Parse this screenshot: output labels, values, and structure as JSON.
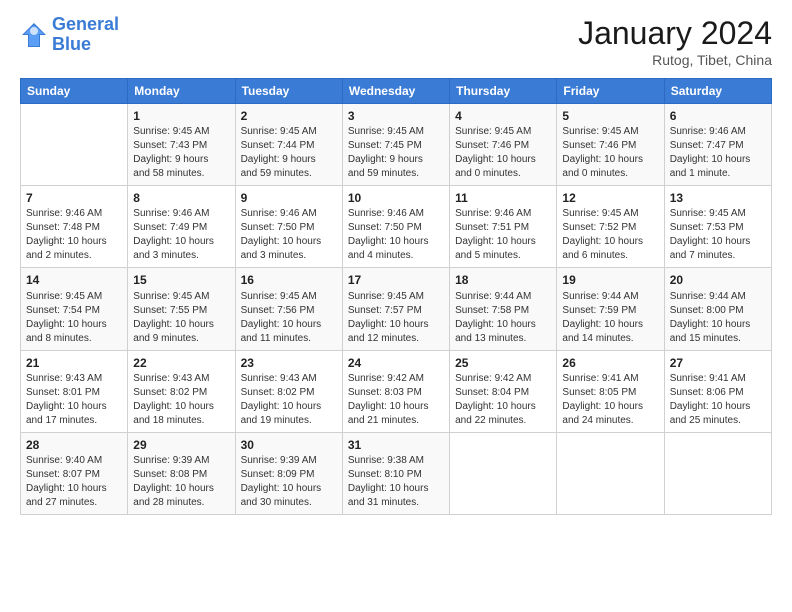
{
  "logo": {
    "line1": "General",
    "line2": "Blue"
  },
  "title": "January 2024",
  "subtitle": "Rutog, Tibet, China",
  "days": [
    "Sunday",
    "Monday",
    "Tuesday",
    "Wednesday",
    "Thursday",
    "Friday",
    "Saturday"
  ],
  "weeks": [
    [
      {
        "date": "",
        "text": ""
      },
      {
        "date": "1",
        "text": "Sunrise: 9:45 AM\nSunset: 7:43 PM\nDaylight: 9 hours\nand 58 minutes."
      },
      {
        "date": "2",
        "text": "Sunrise: 9:45 AM\nSunset: 7:44 PM\nDaylight: 9 hours\nand 59 minutes."
      },
      {
        "date": "3",
        "text": "Sunrise: 9:45 AM\nSunset: 7:45 PM\nDaylight: 9 hours\nand 59 minutes."
      },
      {
        "date": "4",
        "text": "Sunrise: 9:45 AM\nSunset: 7:46 PM\nDaylight: 10 hours\nand 0 minutes."
      },
      {
        "date": "5",
        "text": "Sunrise: 9:45 AM\nSunset: 7:46 PM\nDaylight: 10 hours\nand 0 minutes."
      },
      {
        "date": "6",
        "text": "Sunrise: 9:46 AM\nSunset: 7:47 PM\nDaylight: 10 hours\nand 1 minute."
      }
    ],
    [
      {
        "date": "7",
        "text": "Sunrise: 9:46 AM\nSunset: 7:48 PM\nDaylight: 10 hours\nand 2 minutes."
      },
      {
        "date": "8",
        "text": "Sunrise: 9:46 AM\nSunset: 7:49 PM\nDaylight: 10 hours\nand 3 minutes."
      },
      {
        "date": "9",
        "text": "Sunrise: 9:46 AM\nSunset: 7:50 PM\nDaylight: 10 hours\nand 3 minutes."
      },
      {
        "date": "10",
        "text": "Sunrise: 9:46 AM\nSunset: 7:50 PM\nDaylight: 10 hours\nand 4 minutes."
      },
      {
        "date": "11",
        "text": "Sunrise: 9:46 AM\nSunset: 7:51 PM\nDaylight: 10 hours\nand 5 minutes."
      },
      {
        "date": "12",
        "text": "Sunrise: 9:45 AM\nSunset: 7:52 PM\nDaylight: 10 hours\nand 6 minutes."
      },
      {
        "date": "13",
        "text": "Sunrise: 9:45 AM\nSunset: 7:53 PM\nDaylight: 10 hours\nand 7 minutes."
      }
    ],
    [
      {
        "date": "14",
        "text": "Sunrise: 9:45 AM\nSunset: 7:54 PM\nDaylight: 10 hours\nand 8 minutes."
      },
      {
        "date": "15",
        "text": "Sunrise: 9:45 AM\nSunset: 7:55 PM\nDaylight: 10 hours\nand 9 minutes."
      },
      {
        "date": "16",
        "text": "Sunrise: 9:45 AM\nSunset: 7:56 PM\nDaylight: 10 hours\nand 11 minutes."
      },
      {
        "date": "17",
        "text": "Sunrise: 9:45 AM\nSunset: 7:57 PM\nDaylight: 10 hours\nand 12 minutes."
      },
      {
        "date": "18",
        "text": "Sunrise: 9:44 AM\nSunset: 7:58 PM\nDaylight: 10 hours\nand 13 minutes."
      },
      {
        "date": "19",
        "text": "Sunrise: 9:44 AM\nSunset: 7:59 PM\nDaylight: 10 hours\nand 14 minutes."
      },
      {
        "date": "20",
        "text": "Sunrise: 9:44 AM\nSunset: 8:00 PM\nDaylight: 10 hours\nand 15 minutes."
      }
    ],
    [
      {
        "date": "21",
        "text": "Sunrise: 9:43 AM\nSunset: 8:01 PM\nDaylight: 10 hours\nand 17 minutes."
      },
      {
        "date": "22",
        "text": "Sunrise: 9:43 AM\nSunset: 8:02 PM\nDaylight: 10 hours\nand 18 minutes."
      },
      {
        "date": "23",
        "text": "Sunrise: 9:43 AM\nSunset: 8:02 PM\nDaylight: 10 hours\nand 19 minutes."
      },
      {
        "date": "24",
        "text": "Sunrise: 9:42 AM\nSunset: 8:03 PM\nDaylight: 10 hours\nand 21 minutes."
      },
      {
        "date": "25",
        "text": "Sunrise: 9:42 AM\nSunset: 8:04 PM\nDaylight: 10 hours\nand 22 minutes."
      },
      {
        "date": "26",
        "text": "Sunrise: 9:41 AM\nSunset: 8:05 PM\nDaylight: 10 hours\nand 24 minutes."
      },
      {
        "date": "27",
        "text": "Sunrise: 9:41 AM\nSunset: 8:06 PM\nDaylight: 10 hours\nand 25 minutes."
      }
    ],
    [
      {
        "date": "28",
        "text": "Sunrise: 9:40 AM\nSunset: 8:07 PM\nDaylight: 10 hours\nand 27 minutes."
      },
      {
        "date": "29",
        "text": "Sunrise: 9:39 AM\nSunset: 8:08 PM\nDaylight: 10 hours\nand 28 minutes."
      },
      {
        "date": "30",
        "text": "Sunrise: 9:39 AM\nSunset: 8:09 PM\nDaylight: 10 hours\nand 30 minutes."
      },
      {
        "date": "31",
        "text": "Sunrise: 9:38 AM\nSunset: 8:10 PM\nDaylight: 10 hours\nand 31 minutes."
      },
      {
        "date": "",
        "text": ""
      },
      {
        "date": "",
        "text": ""
      },
      {
        "date": "",
        "text": ""
      }
    ]
  ]
}
